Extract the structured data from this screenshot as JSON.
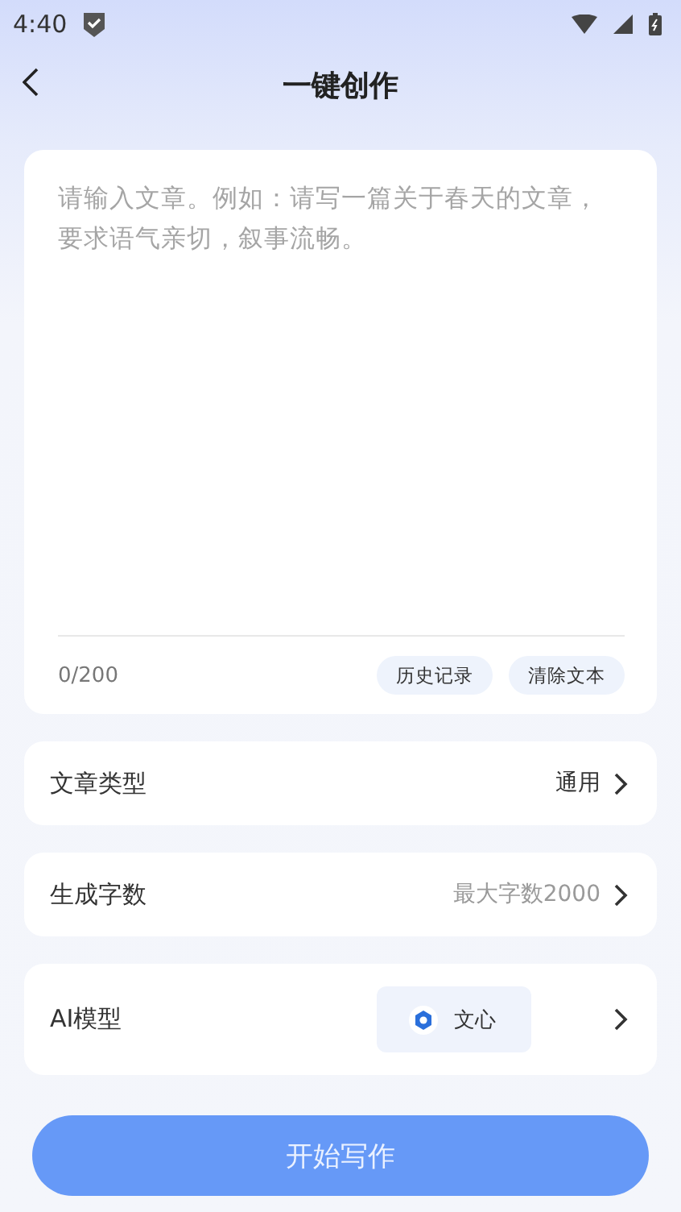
{
  "status_bar": {
    "time": "4:40"
  },
  "header": {
    "title": "一键创作"
  },
  "editor": {
    "placeholder": "请输入文章。例如：请写一篇关于春天的文章，要求语气亲切，叙事流畅。",
    "counter": "0/200",
    "actions": [
      "历史记录",
      "清除文本"
    ]
  },
  "settings": [
    {
      "kind": "value",
      "label": "文章类型",
      "value": "通用",
      "muted": false
    },
    {
      "kind": "value",
      "label": "生成字数",
      "value": "最大字数2000",
      "muted": true
    },
    {
      "kind": "model",
      "label": "AI模型",
      "value": "文心"
    }
  ],
  "primary_button": {
    "label": "开始写作"
  }
}
